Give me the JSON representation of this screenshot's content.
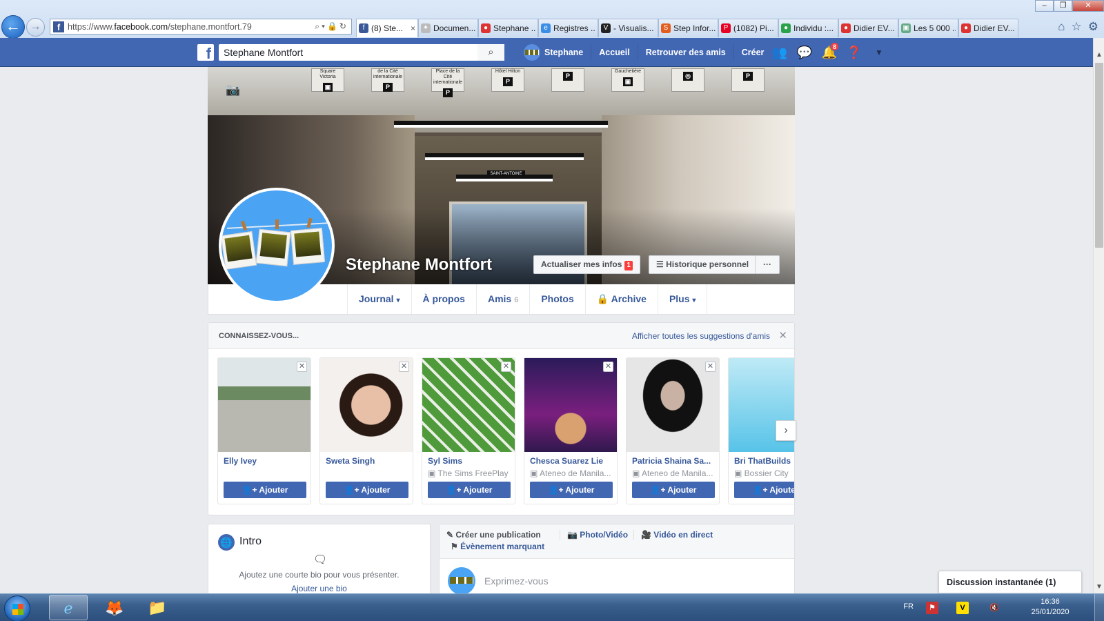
{
  "browser": {
    "url_prefix": "https://www.",
    "url_host": "facebook.com",
    "url_path": "/stephane.montfort.79",
    "window_controls": [
      "–",
      "❐",
      "✕"
    ],
    "tabs": [
      {
        "label": "(8) Ste...",
        "icon": "facebook-icon",
        "color": "#3b5998",
        "glyph": "f",
        "close": "×"
      },
      {
        "label": "Documen...",
        "icon": "star-icon",
        "color": "#bbb",
        "glyph": "✦"
      },
      {
        "label": "Stephane ...",
        "icon": "site-icon",
        "color": "#d33",
        "glyph": "●"
      },
      {
        "label": "Registres ...",
        "icon": "ie-icon",
        "color": "#3a8ee6",
        "glyph": "e"
      },
      {
        "label": "- Visualis...",
        "icon": "visualis-icon",
        "color": "#222",
        "glyph": "V"
      },
      {
        "label": "Step Infor...",
        "icon": "step-icon",
        "color": "#e25d1e",
        "glyph": "S"
      },
      {
        "label": "(1082) Pi...",
        "icon": "pinterest-icon",
        "color": "#e60023",
        "glyph": "P"
      },
      {
        "label": "Individu :...",
        "icon": "individu-icon",
        "color": "#2aa24a",
        "glyph": "●"
      },
      {
        "label": "Didier EV...",
        "icon": "site-icon",
        "color": "#d33",
        "glyph": "●"
      },
      {
        "label": "Les 5 000 ...",
        "icon": "isq-icon",
        "color": "#6a8",
        "glyph": "▣"
      },
      {
        "label": "Didier EV...",
        "icon": "site-icon",
        "color": "#d33",
        "glyph": "●"
      }
    ],
    "right_icons": [
      "home-icon",
      "star-icon",
      "gear-icon"
    ]
  },
  "fb": {
    "search_value": "Stephane Montfort",
    "nav": {
      "profile": "Stephane",
      "home": "Accueil",
      "find_friends": "Retrouver des amis",
      "create": "Créer"
    },
    "notif_count": "8"
  },
  "profile": {
    "name": "Stephane Montfort",
    "update_info": "Actualiser mes infos",
    "update_badge": "1",
    "activity_log": "Historique personnel",
    "more": "···"
  },
  "cover_signs": [
    {
      "text": "Square Victoria",
      "glyph": "▣"
    },
    {
      "text": "de la Cité internationale",
      "glyph": "P"
    },
    {
      "text": "Place de la Cité internationale",
      "glyph": "P"
    },
    {
      "text": "Hôtel Hilton",
      "glyph": "P"
    },
    {
      "text": "",
      "glyph": "P"
    },
    {
      "text": "Gauchetière",
      "glyph": "▣"
    },
    {
      "text": "",
      "glyph": "◎"
    },
    {
      "text": "",
      "glyph": "P"
    }
  ],
  "cover_station": "SAINT-ANTOINE",
  "tabs": [
    {
      "label": "Journal",
      "caret": "▾"
    },
    {
      "label": "À propos"
    },
    {
      "label": "Amis",
      "count": "6"
    },
    {
      "label": "Photos"
    },
    {
      "label": "Archive",
      "icon": "lock-icon"
    },
    {
      "label": "Plus",
      "caret": "▾"
    }
  ],
  "suggestions": {
    "title": "CONNAISSEZ-VOUS...",
    "see_all": "Afficher toutes les suggestions d'amis",
    "add_label": "Ajouter",
    "people": [
      {
        "name": "Elly Ivey",
        "sub": ""
      },
      {
        "name": "Sweta Singh",
        "sub": ""
      },
      {
        "name": "Syl Sims",
        "sub": "The Sims FreePlay"
      },
      {
        "name": "Chesca Suarez Lie",
        "sub": "Ateneo de Manila..."
      },
      {
        "name": "Patricia Shaina Sa...",
        "sub": "Ateneo de Manila..."
      },
      {
        "name": "Bri ThatBuilds",
        "sub": "Bossier City"
      }
    ]
  },
  "intro": {
    "title": "Intro",
    "text": "Ajoutez une courte bio pour vous présenter.",
    "link": "Ajouter une bio"
  },
  "composer": {
    "create_post": "Créer une publication",
    "photo_video": "Photo/Vidéo",
    "live_video": "Vidéo en direct",
    "life_event": "Évènement marquant",
    "placeholder": "Exprimez-vous"
  },
  "chat": {
    "label": "Discussion instantanée (1)"
  },
  "taskbar": {
    "lang": "FR",
    "time": "16:36",
    "date": "25/01/2020"
  }
}
